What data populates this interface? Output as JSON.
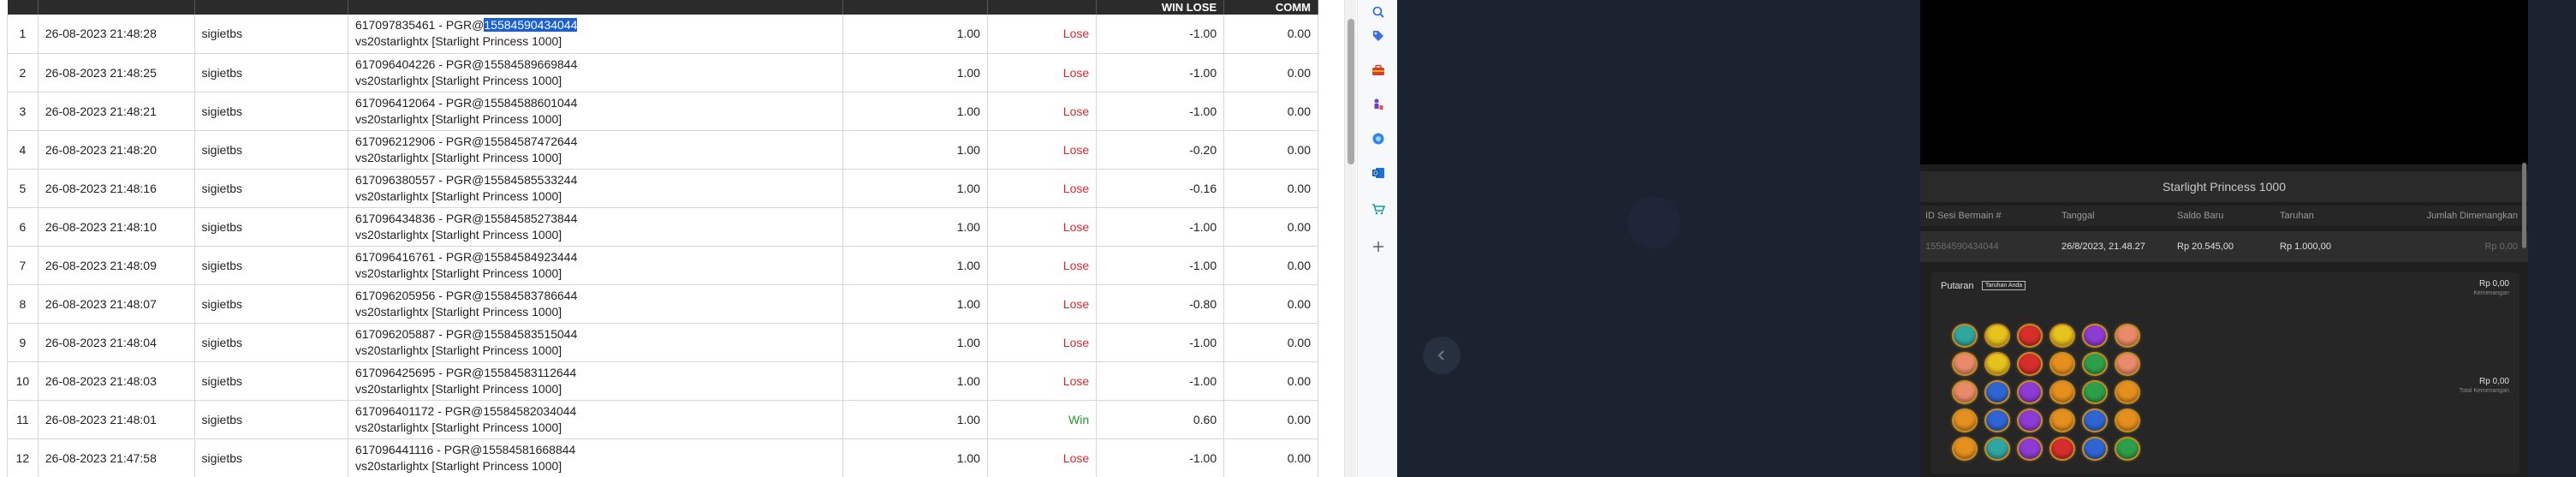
{
  "table": {
    "headers": [
      "",
      "",
      "",
      "",
      "",
      "",
      "WIN LOSE",
      "COMM"
    ],
    "rows": [
      {
        "no": "1",
        "date": "26-08-2023 21:48:28",
        "user": "sigietbs",
        "bet_id_pre": "617097835461 - PGR@",
        "bet_id_sel": "15584590434044",
        "bet_id_post": "",
        "game": "vs20starlightx [Starlight Princess 1000]",
        "stake": "1.00",
        "result": "Lose",
        "winlose": "-1.00",
        "comm": "0.00"
      },
      {
        "no": "2",
        "date": "26-08-2023 21:48:25",
        "user": "sigietbs",
        "bet_id_pre": "617096404226 - PGR@15584589669844",
        "bet_id_sel": "",
        "bet_id_post": "",
        "game": "vs20starlightx [Starlight Princess 1000]",
        "stake": "1.00",
        "result": "Lose",
        "winlose": "-1.00",
        "comm": "0.00"
      },
      {
        "no": "3",
        "date": "26-08-2023 21:48:21",
        "user": "sigietbs",
        "bet_id_pre": "617096412064 - PGR@15584588601044",
        "bet_id_sel": "",
        "bet_id_post": "",
        "game": "vs20starlightx [Starlight Princess 1000]",
        "stake": "1.00",
        "result": "Lose",
        "winlose": "-1.00",
        "comm": "0.00"
      },
      {
        "no": "4",
        "date": "26-08-2023 21:48:20",
        "user": "sigietbs",
        "bet_id_pre": "617096212906 - PGR@15584587472644",
        "bet_id_sel": "",
        "bet_id_post": "",
        "game": "vs20starlightx [Starlight Princess 1000]",
        "stake": "1.00",
        "result": "Lose",
        "winlose": "-0.20",
        "comm": "0.00"
      },
      {
        "no": "5",
        "date": "26-08-2023 21:48:16",
        "user": "sigietbs",
        "bet_id_pre": "617096380557 - PGR@15584585533244",
        "bet_id_sel": "",
        "bet_id_post": "",
        "game": "vs20starlightx [Starlight Princess 1000]",
        "stake": "1.00",
        "result": "Lose",
        "winlose": "-0.16",
        "comm": "0.00"
      },
      {
        "no": "6",
        "date": "26-08-2023 21:48:10",
        "user": "sigietbs",
        "bet_id_pre": "617096434836 - PGR@15584585273844",
        "bet_id_sel": "",
        "bet_id_post": "",
        "game": "vs20starlightx [Starlight Princess 1000]",
        "stake": "1.00",
        "result": "Lose",
        "winlose": "-1.00",
        "comm": "0.00"
      },
      {
        "no": "7",
        "date": "26-08-2023 21:48:09",
        "user": "sigietbs",
        "bet_id_pre": "617096416761 - PGR@15584584923444",
        "bet_id_sel": "",
        "bet_id_post": "",
        "game": "vs20starlightx [Starlight Princess 1000]",
        "stake": "1.00",
        "result": "Lose",
        "winlose": "-1.00",
        "comm": "0.00"
      },
      {
        "no": "8",
        "date": "26-08-2023 21:48:07",
        "user": "sigietbs",
        "bet_id_pre": "617096205956 - PGR@15584583786644",
        "bet_id_sel": "",
        "bet_id_post": "",
        "game": "vs20starlightx [Starlight Princess 1000]",
        "stake": "1.00",
        "result": "Lose",
        "winlose": "-0.80",
        "comm": "0.00"
      },
      {
        "no": "9",
        "date": "26-08-2023 21:48:04",
        "user": "sigietbs",
        "bet_id_pre": "617096205887 - PGR@15584583515044",
        "bet_id_sel": "",
        "bet_id_post": "",
        "game": "vs20starlightx [Starlight Princess 1000]",
        "stake": "1.00",
        "result": "Lose",
        "winlose": "-1.00",
        "comm": "0.00"
      },
      {
        "no": "10",
        "date": "26-08-2023 21:48:03",
        "user": "sigietbs",
        "bet_id_pre": "617096425695 - PGR@15584583112644",
        "bet_id_sel": "",
        "bet_id_post": "",
        "game": "vs20starlightx [Starlight Princess 1000]",
        "stake": "1.00",
        "result": "Lose",
        "winlose": "-1.00",
        "comm": "0.00"
      },
      {
        "no": "11",
        "date": "26-08-2023 21:48:01",
        "user": "sigietbs",
        "bet_id_pre": "617096401172 - PGR@15584582034044",
        "bet_id_sel": "",
        "bet_id_post": "",
        "game": "vs20starlightx [Starlight Princess 1000]",
        "stake": "1.00",
        "result": "Win",
        "winlose": "0.60",
        "comm": "0.00"
      },
      {
        "no": "12",
        "date": "26-08-2023 21:47:58",
        "user": "sigietbs",
        "bet_id_pre": "617096441116 - PGR@15584581668844",
        "bet_id_sel": "",
        "bet_id_post": "",
        "game": "vs20starlightx [Starlight Princess 1000]",
        "stake": "1.00",
        "result": "Lose",
        "winlose": "-1.00",
        "comm": "0.00"
      }
    ]
  },
  "side_panel": {
    "icons": [
      "search-icon",
      "tag-icon",
      "briefcase-icon",
      "chess-icon",
      "copilot-icon",
      "outlook-icon",
      "shopping-cart-icon",
      "add-icon"
    ]
  },
  "game_detail": {
    "title": "Starlight Princess 1000",
    "columns": [
      "ID Sesi Bermain #",
      "Tanggal",
      "Saldo Baru",
      "Taruhan",
      "Jumlah Dimenangkan"
    ],
    "row": {
      "session_id": "15584590434044",
      "date": "26/8/2023, 21.48.27",
      "balance": "Rp 20.545,00",
      "bet": "Rp 1.000,00",
      "won": "Rp 0,00"
    },
    "spin_label": "Putaran",
    "spin_tag": "Taruhan Anda",
    "win1_amount": "Rp 0,00",
    "win1_label": "Kemenangan",
    "win2_amount": "Rp 0,00",
    "win2_label": "Total Kemenangan",
    "grid": [
      [
        "t",
        "y",
        "r",
        "y",
        "p",
        "h"
      ],
      [
        "h",
        "y",
        "r",
        "o",
        "g",
        "h"
      ],
      [
        "h",
        "b",
        "p",
        "o",
        "g",
        "o"
      ],
      [
        "o",
        "b",
        "p",
        "o",
        "b",
        "o"
      ],
      [
        "o",
        "t",
        "p",
        "r",
        "b",
        "g"
      ]
    ]
  },
  "colors": {
    "lose": "#e0262e",
    "win": "#1e9c2a",
    "selection": "#1a5fd6"
  }
}
